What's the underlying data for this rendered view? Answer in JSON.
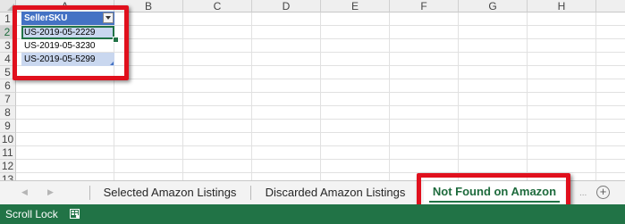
{
  "columns": [
    "A",
    "B",
    "C",
    "D",
    "E",
    "F",
    "G",
    "H"
  ],
  "rows": [
    "1",
    "2",
    "3",
    "4",
    "5",
    "6",
    "7",
    "8",
    "9",
    "10",
    "11",
    "12",
    "13"
  ],
  "table": {
    "header": "SellerSKU",
    "cells": [
      "US-2019-05-2229",
      "US-2019-05-3230",
      "US-2019-05-5299"
    ]
  },
  "sheet_tabs": [
    {
      "label": "Selected Amazon Listings"
    },
    {
      "label": "Discarded Amazon Listings"
    },
    {
      "label": "Not Found on Amazon",
      "active": true
    }
  ],
  "tab_more": "...",
  "add_sheet": "+",
  "status_bar": {
    "text": "Scroll Lock"
  },
  "colors": {
    "excel_green": "#217346",
    "table_header": "#4472c4",
    "table_band": "#c9d7ef",
    "annotation_red": "#e0101d"
  },
  "icons": [
    "corner-select-icon",
    "filter-dropdown-icon",
    "scroll-left-icon",
    "scroll-right-icon",
    "add-sheet-icon",
    "macro-record-icon"
  ]
}
